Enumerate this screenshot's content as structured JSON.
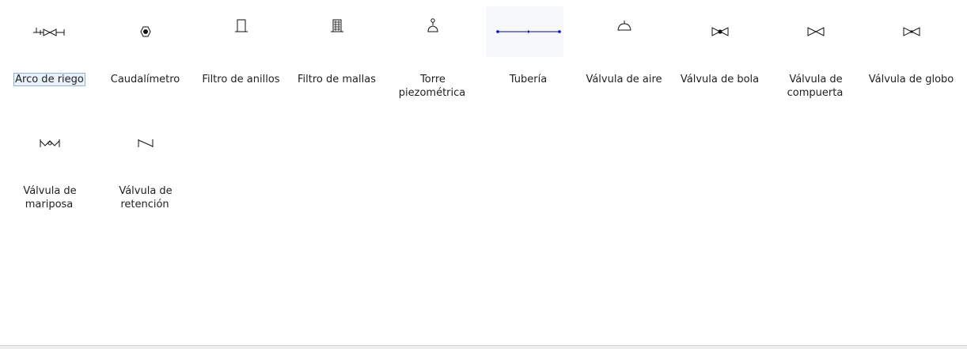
{
  "palette": {
    "items": [
      {
        "label": "Arco de riego",
        "icon": "irrigation-arc-icon",
        "selected": true
      },
      {
        "label": "Caudalímetro",
        "icon": "flowmeter-icon"
      },
      {
        "label": "Filtro de anillos",
        "icon": "ring-filter-icon"
      },
      {
        "label": "Filtro de mallas",
        "icon": "mesh-filter-icon"
      },
      {
        "label": "Torre piezométrica",
        "icon": "piezometric-tower-icon"
      },
      {
        "label": "Tubería",
        "icon": "pipe-icon"
      },
      {
        "label": "Válvula de aire",
        "icon": "air-valve-icon"
      },
      {
        "label": "Válvula de bola",
        "icon": "ball-valve-icon"
      },
      {
        "label": "Válvula de compuerta",
        "icon": "gate-valve-icon"
      },
      {
        "label": "Válvula de globo",
        "icon": "globe-valve-icon"
      },
      {
        "label": "Válvula de mariposa",
        "icon": "butterfly-valve-icon"
      },
      {
        "label": "Válvula de retención",
        "icon": "check-valve-icon"
      }
    ]
  },
  "colors": {
    "pipe": "#0000cc",
    "symbol": "#111111",
    "selection_fill": "#e9f1fb",
    "selection_border": "#8fb2d8"
  }
}
